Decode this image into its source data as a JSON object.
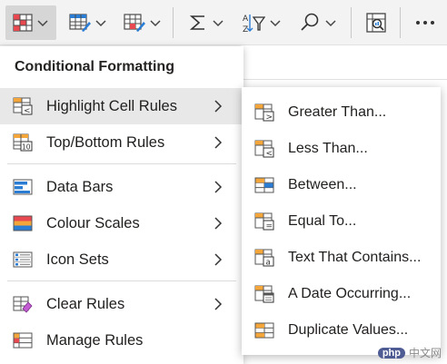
{
  "ribbon": {
    "buttons": [
      {
        "icon": "conditional-formatting-icon",
        "active": true
      },
      {
        "icon": "format-as-table-icon"
      },
      {
        "icon": "cell-styles-icon"
      },
      {
        "icon": "autosum-icon"
      },
      {
        "icon": "sort-filter-icon"
      },
      {
        "icon": "find-select-icon"
      },
      {
        "icon": "analyse-data-icon"
      },
      {
        "icon": "more-options-icon"
      }
    ]
  },
  "menu": {
    "title": "Conditional Formatting",
    "items": [
      {
        "label": "Highlight Cell Rules",
        "icon": "highlight-cell-rules-icon",
        "has_submenu": true,
        "highlighted": true
      },
      {
        "label": "Top/Bottom Rules",
        "icon": "top-bottom-rules-icon",
        "has_submenu": true
      },
      {
        "label": "Data Bars",
        "icon": "data-bars-icon",
        "has_submenu": true
      },
      {
        "label": "Colour Scales",
        "icon": "colour-scales-icon",
        "has_submenu": true
      },
      {
        "label": "Icon Sets",
        "icon": "icon-sets-icon",
        "has_submenu": true
      },
      {
        "label": "Clear Rules",
        "icon": "clear-rules-icon",
        "has_submenu": true
      },
      {
        "label": "Manage Rules",
        "icon": "manage-rules-icon",
        "has_submenu": false
      }
    ]
  },
  "submenu": {
    "items": [
      {
        "label": "Greater Than...",
        "icon": "greater-than-icon"
      },
      {
        "label": "Less Than...",
        "icon": "less-than-icon"
      },
      {
        "label": "Between...",
        "icon": "between-icon"
      },
      {
        "label": "Equal To...",
        "icon": "equal-to-icon"
      },
      {
        "label": "Text That Contains...",
        "icon": "text-contains-icon"
      },
      {
        "label": "A Date Occurring...",
        "icon": "date-occurring-icon"
      },
      {
        "label": "Duplicate Values...",
        "icon": "duplicate-values-icon"
      }
    ]
  },
  "colors": {
    "accent_orange": "#f4a63a",
    "accent_red": "#e8484f",
    "accent_blue": "#2b7cd3",
    "highlight": "#e8e8e8"
  },
  "watermark": {
    "badge": "php",
    "text": "中文网"
  }
}
